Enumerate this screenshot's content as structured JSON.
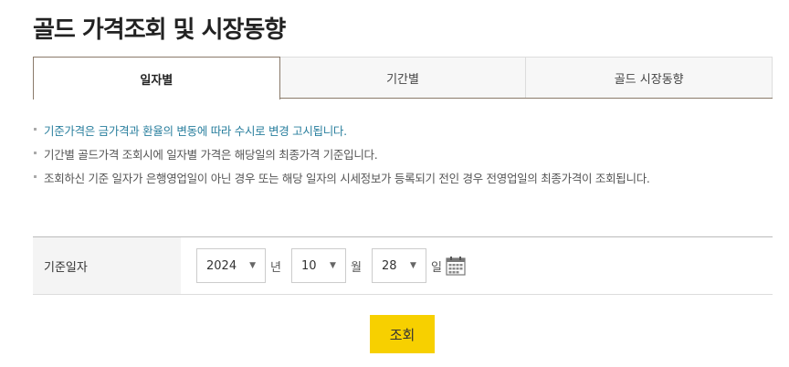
{
  "page": {
    "title": "골드 가격조회 및 시장동향"
  },
  "tabs": [
    {
      "label": "일자별",
      "active": true
    },
    {
      "label": "기간별",
      "active": false
    },
    {
      "label": "골드 시장동향",
      "active": false
    }
  ],
  "notices": [
    "기준가격은 금가격과 환율의 변동에 따라 수시로 변경 고시됩니다.",
    "기간별 골드가격 조회시에 일자별 가격은 해당일의 최종가격 기준입니다.",
    "조회하신 기준 일자가 은행영업일이 아닌 경우 또는 해당 일자의 시세정보가 등록되기 전인 경우 전영업일의 최종가격이 조회됩니다."
  ],
  "form": {
    "label": "기준일자",
    "year": {
      "value": "2024",
      "unit": "년"
    },
    "month": {
      "value": "10",
      "unit": "월"
    },
    "day": {
      "value": "28",
      "unit": "일"
    },
    "calendar_icon": "calendar-icon"
  },
  "search_button": {
    "label": "조회"
  },
  "colors": {
    "accent": "#f7d000",
    "notice_highlight": "#2a7f9e"
  }
}
